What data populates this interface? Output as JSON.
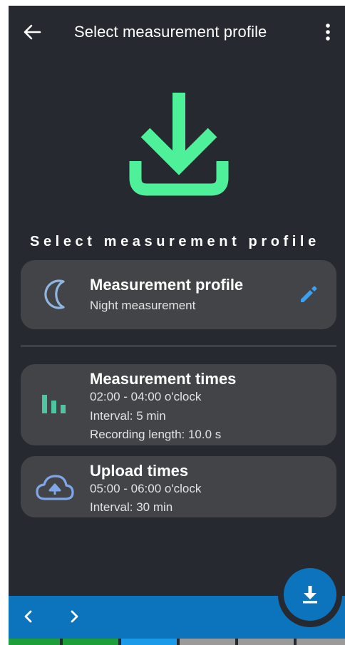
{
  "header": {
    "title": "Select measurement profile",
    "back_icon": "arrow-left-icon",
    "menu_icon": "more-vert-icon"
  },
  "hero": {
    "icon": "download-icon",
    "color": "#4ef09a"
  },
  "section_heading": "Select measurement profile",
  "profile_card": {
    "icon": "moon-icon",
    "title": "Measurement profile",
    "subtitle": "Night measurement",
    "edit_icon": "pencil-icon"
  },
  "times_card": {
    "icon": "bar-chart-icon",
    "title": "Measurement times",
    "lines": [
      "02:00 - 04:00 o'clock",
      "Interval: 5 min",
      "Recording length: 10.0 s"
    ]
  },
  "upload_card": {
    "icon": "cloud-upload-icon",
    "title": "Upload times",
    "lines": [
      "05:00 - 06:00 o'clock",
      "Interval: 30 min"
    ]
  },
  "bottom_nav": {
    "prev_icon": "chevron-left-icon",
    "next_icon": "chevron-right-icon",
    "fab_icon": "download-icon"
  },
  "colors": {
    "background": "#262a30",
    "card": "#434447",
    "accent_green": "#4ef09a",
    "accent_blue": "#0b74bd",
    "moon": "#8fb6e0",
    "chart": "#4fc4a3",
    "cloud": "#7fa6e8",
    "pencil": "#3ba0f0"
  },
  "progress_segments": [
    {
      "state": "complete",
      "color": "#1e9e3a"
    },
    {
      "state": "complete",
      "color": "#1e9e3a"
    },
    {
      "state": "active",
      "color": "#1a9ae8"
    },
    {
      "state": "pending",
      "color": "#9a9a9a"
    },
    {
      "state": "pending",
      "color": "#9a9a9a"
    },
    {
      "state": "pending",
      "color": "#9a9a9a"
    }
  ]
}
